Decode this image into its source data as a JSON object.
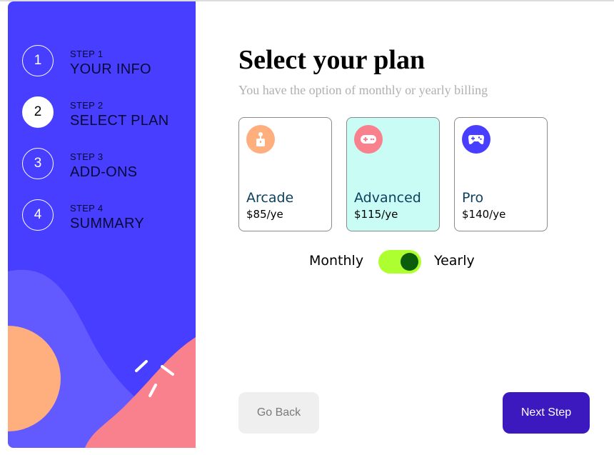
{
  "steps": [
    {
      "number": "1",
      "label": "STEP 1",
      "name": "YOUR INFO",
      "active": false
    },
    {
      "number": "2",
      "label": "STEP 2",
      "name": "SELECT PLAN",
      "active": true
    },
    {
      "number": "3",
      "label": "STEP 3",
      "name": "ADD-ONS",
      "active": false
    },
    {
      "number": "4",
      "label": "STEP 4",
      "name": "SUMMARY",
      "active": false
    }
  ],
  "main": {
    "title": "Select your plan",
    "subtitle": "You have the option of monthly or yearly billing"
  },
  "plans": [
    {
      "name": "Arcade",
      "price": "$85/ye",
      "icon": "arcade-joystick-icon",
      "icon_color": "#ffaf7e",
      "selected": false
    },
    {
      "name": "Advanced",
      "price": "$115/ye",
      "icon": "advanced-gamepad-icon",
      "icon_color": "#f9818e",
      "selected": true
    },
    {
      "name": "Pro",
      "price": "$140/ye",
      "icon": "pro-controller-icon",
      "icon_color": "#483eff",
      "selected": false
    }
  ],
  "billing": {
    "monthly_label": "Monthly",
    "yearly_label": "Yearly",
    "selected": "yearly"
  },
  "buttons": {
    "back": "Go Back",
    "next": "Next Step"
  },
  "colors": {
    "sidebar": "#483eff",
    "accent_dark": "#3b19bf",
    "selected_card": "#c9fcf5",
    "toggle_track": "#adff2f",
    "toggle_knob": "#0b5d0b"
  }
}
